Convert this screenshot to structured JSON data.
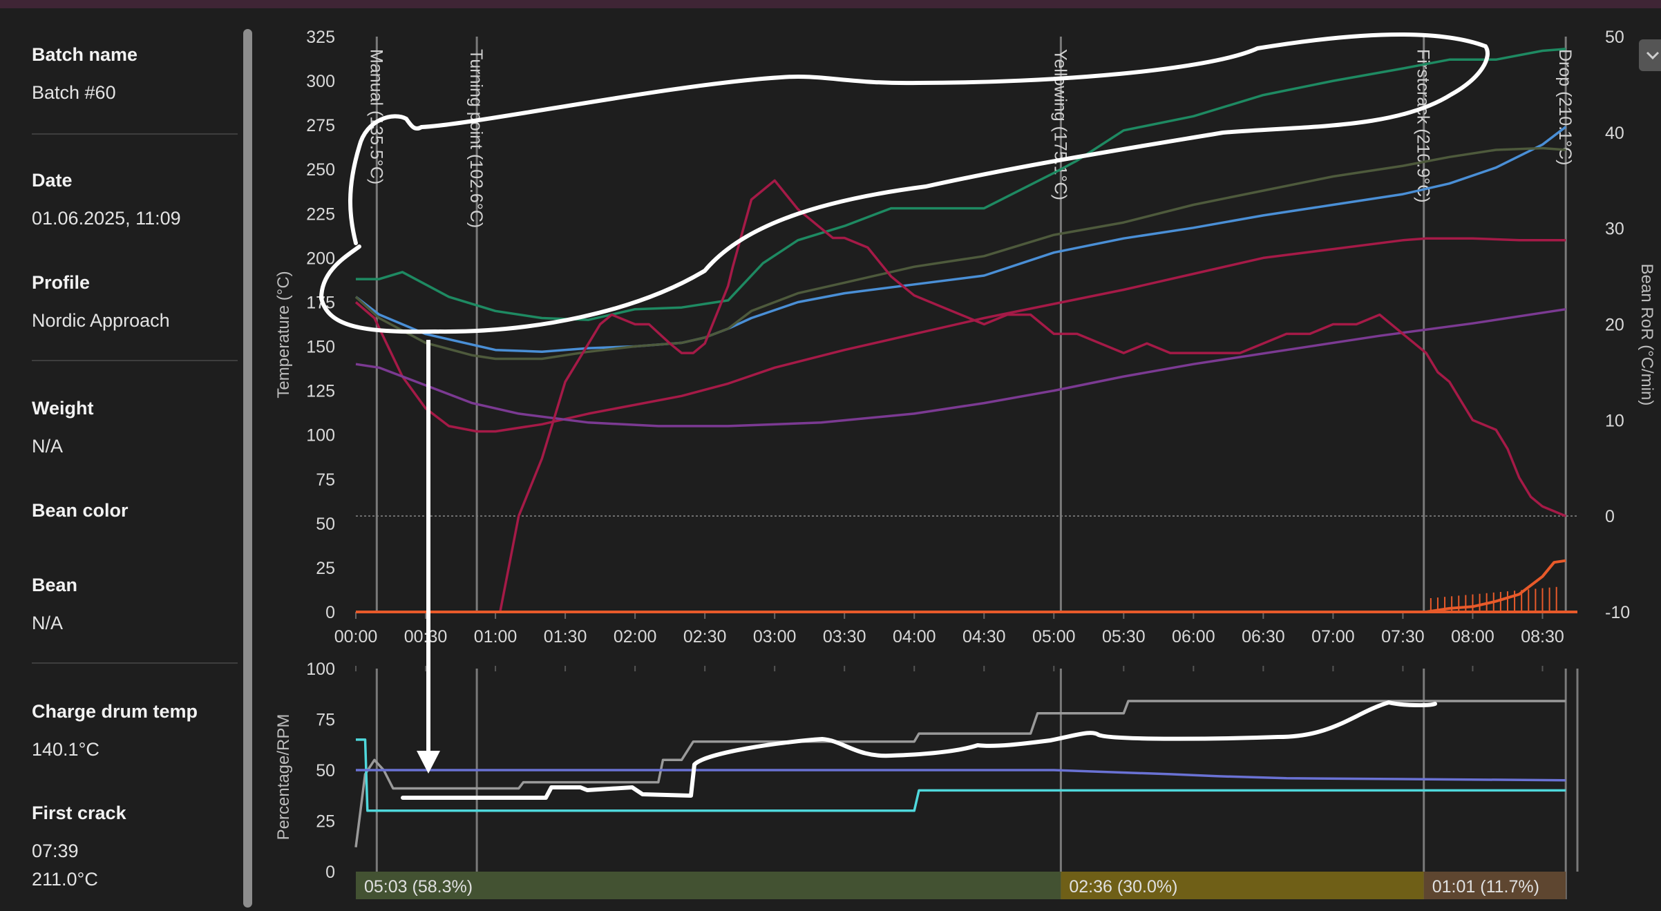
{
  "sidebar": {
    "fields": [
      {
        "label": "Batch name",
        "value": "Batch #60"
      },
      {
        "label": "Date",
        "value": "01.06.2025, 11:09"
      },
      {
        "label": "Profile",
        "value": "Nordic Approach"
      },
      {
        "label": "Weight",
        "value": "N/A"
      },
      {
        "label": "Bean color",
        "value": ""
      },
      {
        "label": "Bean",
        "value": "N/A"
      },
      {
        "label": "Charge drum temp",
        "value": "140.1°C"
      },
      {
        "label": "First crack",
        "value": "07:39",
        "value2": "211.0°C"
      }
    ]
  },
  "colors": {
    "background": "#1e1e1e",
    "green": "#1e8a62",
    "blue": "#4a8fd6",
    "olive": "#4e5a3c",
    "crimson": "#a51a47",
    "purple": "#7b3a92",
    "orange": "#e85a2a",
    "cyan": "#4fd8dc",
    "indigo": "#6a72d4",
    "gray": "#9a9a9a",
    "phase_drying": "#435232",
    "phase_maillard": "#6f5f17",
    "phase_development": "#5e4630"
  },
  "chart_data": [
    {
      "type": "line",
      "ylabel": "Temperature (°C)",
      "y2label": "Bean RoR (°C/min)",
      "ylim": [
        0,
        325
      ],
      "y2lim": [
        -10,
        50
      ],
      "x_ticks": [
        "00:00",
        "00:30",
        "01:00",
        "01:30",
        "02:00",
        "02:30",
        "03:00",
        "03:30",
        "04:00",
        "04:30",
        "05:00",
        "05:30",
        "06:00",
        "06:30",
        "07:00",
        "07:30",
        "08:00",
        "08:30"
      ],
      "y_ticks": [
        0,
        25,
        50,
        75,
        100,
        125,
        150,
        175,
        200,
        225,
        250,
        275,
        300,
        325
      ],
      "y2_ticks": [
        -10,
        0,
        10,
        20,
        30,
        40,
        50
      ],
      "events": [
        {
          "label": "Manual (135.5°C)",
          "time": 9
        },
        {
          "label": "Turning point (102.6°C)",
          "time": 52
        },
        {
          "label": "Yellowing (175.1°C)",
          "time": 303
        },
        {
          "label": "Firstcrack (210.9°C)",
          "time": 459
        },
        {
          "label": "Drop (210.1°C)",
          "time": 520
        }
      ],
      "series": [
        {
          "color": "#1e8a62",
          "x": [
            0,
            10,
            20,
            40,
            60,
            80,
            100,
            120,
            140,
            150,
            160,
            175,
            190,
            210,
            230,
            270,
            300,
            310,
            330,
            360,
            390,
            420,
            450,
            470,
            490,
            510,
            520
          ],
          "values": [
            188,
            188,
            192,
            178,
            170,
            166,
            165,
            171,
            172,
            174,
            176,
            197,
            210,
            218,
            228,
            228,
            248,
            255,
            272,
            280,
            292,
            300,
            307,
            312,
            312,
            317,
            318
          ]
        },
        {
          "color": "#4a8fd6",
          "x": [
            0,
            10,
            30,
            60,
            80,
            100,
            120,
            140,
            150,
            160,
            170,
            190,
            210,
            240,
            270,
            300,
            330,
            360,
            390,
            420,
            450,
            470,
            490,
            510,
            520
          ],
          "values": [
            178,
            168,
            157,
            148,
            147,
            149,
            150,
            152,
            155,
            160,
            166,
            175,
            180,
            185,
            190,
            203,
            211,
            217,
            224,
            230,
            236,
            242,
            251,
            264,
            274
          ]
        },
        {
          "color": "#4e5a3c",
          "x": [
            0,
            10,
            30,
            50,
            60,
            80,
            100,
            120,
            140,
            150,
            160,
            170,
            190,
            210,
            240,
            270,
            300,
            330,
            360,
            390,
            420,
            450,
            470,
            490,
            510,
            520
          ],
          "values": [
            178,
            166,
            152,
            145,
            143,
            143,
            147,
            150,
            152,
            155,
            160,
            170,
            180,
            186,
            195,
            201,
            213,
            220,
            230,
            238,
            246,
            252,
            257,
            261,
            262,
            261
          ]
        },
        {
          "color": "#a51a47",
          "x": [
            0,
            8,
            20,
            30,
            40,
            52,
            60,
            80,
            100,
            120,
            140,
            160,
            180,
            210,
            240,
            270,
            300,
            330,
            360,
            390,
            420,
            450,
            460,
            480,
            500,
            520
          ],
          "values": [
            175,
            166,
            133,
            115,
            105,
            102,
            102,
            106,
            112,
            117,
            122,
            129,
            138,
            148,
            157,
            166,
            174,
            182,
            191,
            200,
            205,
            210,
            211,
            211,
            210,
            210
          ]
        },
        {
          "color": "#7b3a92",
          "x": [
            0,
            10,
            30,
            50,
            70,
            100,
            130,
            160,
            200,
            240,
            270,
            300,
            330,
            360,
            400,
            440,
            480,
            520
          ],
          "values": [
            140,
            138,
            128,
            118,
            112,
            107,
            105,
            105,
            107,
            112,
            118,
            125,
            133,
            140,
            148,
            156,
            163,
            171
          ]
        },
        {
          "color": "#e85a2a",
          "x": [
            0,
            460,
            470,
            480,
            490,
            500,
            510,
            515,
            520
          ],
          "values": [
            0,
            0,
            2,
            3,
            6,
            10,
            20,
            28,
            29
          ]
        }
      ],
      "ror": {
        "color": "#a51a47",
        "x": [
          62,
          66,
          70,
          80,
          90,
          100,
          105,
          110,
          120,
          126,
          135,
          140,
          145,
          150,
          160,
          162,
          170,
          180,
          190,
          200,
          205,
          210,
          220,
          230,
          240,
          250,
          260,
          270,
          280,
          290,
          300,
          310,
          320,
          330,
          340,
          350,
          360,
          370,
          380,
          390,
          400,
          410,
          420,
          430,
          440,
          450,
          460,
          465,
          470,
          475,
          480,
          490,
          495,
          500,
          505,
          510,
          520
        ],
        "values": [
          -10,
          -5,
          0,
          6,
          14,
          18,
          20,
          21,
          20,
          20,
          18,
          17,
          17,
          18,
          24,
          26,
          33,
          35,
          32,
          30,
          29,
          29,
          28,
          25,
          23,
          22,
          21,
          20,
          21,
          21,
          19,
          19,
          18,
          17,
          18,
          17,
          17,
          17,
          17,
          18,
          19,
          19,
          20,
          20,
          21,
          19,
          17,
          15,
          14,
          12,
          10,
          9,
          7,
          4,
          2,
          1,
          0
        ]
      },
      "ror_reference": 0
    },
    {
      "type": "line",
      "ylabel": "Percentage/RPM",
      "ylim": [
        0,
        100
      ],
      "y_ticks": [
        0,
        25,
        50,
        75,
        100
      ],
      "series": [
        {
          "color": "#9a9a9a",
          "x": [
            0,
            4,
            8,
            12,
            16,
            20,
            50,
            70,
            72,
            130,
            132,
            140,
            145,
            240,
            242,
            290,
            293,
            300,
            302,
            330,
            332,
            380,
            382,
            520
          ],
          "values": [
            12,
            48,
            55,
            50,
            41,
            41,
            41,
            41,
            44,
            44,
            55,
            55,
            64,
            64,
            68,
            68,
            78,
            78,
            78,
            78,
            84,
            84,
            84,
            84
          ]
        },
        {
          "color": "#4fd8dc",
          "x": [
            0,
            4,
            5,
            8,
            240,
            242,
            520
          ],
          "values": [
            65,
            65,
            30,
            30,
            30,
            40,
            40
          ]
        },
        {
          "color": "#6a72d4",
          "x": [
            0,
            300,
            350,
            370,
            400,
            520
          ],
          "values": [
            50,
            50,
            48,
            47,
            46,
            45
          ]
        }
      ],
      "phases": [
        {
          "label": "05:03 (58.3%)",
          "color": "#435232"
        },
        {
          "label": "02:36 (30.0%)",
          "color": "#6f5f17"
        },
        {
          "label": "01:01 (11.7%)",
          "color": "#5e4630"
        }
      ]
    }
  ]
}
